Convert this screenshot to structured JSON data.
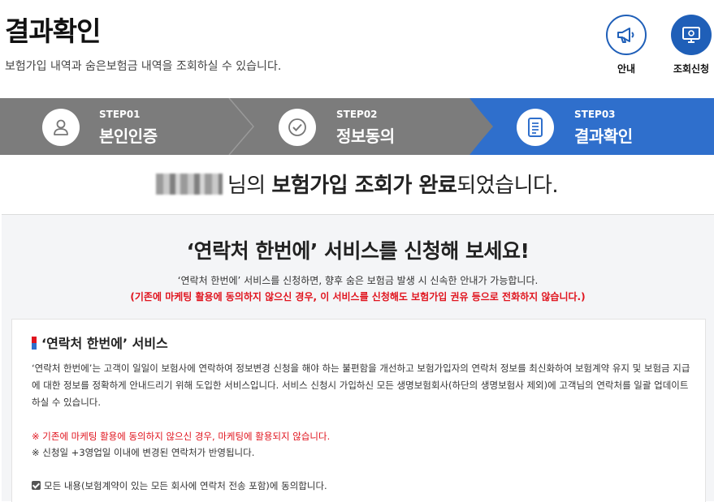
{
  "page": {
    "title": "결과확인",
    "description": "보험가입 내역과 숨은보험금 내역을 조회하실 수 있습니다."
  },
  "top_actions": [
    {
      "label": "안내",
      "icon": "megaphone-icon"
    },
    {
      "label": "조회신청",
      "icon": "monitor-icon"
    }
  ],
  "steps": [
    {
      "no": "STEP01",
      "name": "본인인증",
      "icon": "person-icon",
      "active": false
    },
    {
      "no": "STEP02",
      "name": "정보동의",
      "icon": "check-circle-icon",
      "active": false
    },
    {
      "no": "STEP03",
      "name": "결과확인",
      "icon": "document-icon",
      "active": true
    }
  ],
  "result": {
    "suffix_1": "님의 ",
    "bold": "보험가입 조회가 완료",
    "suffix_2": "되었습니다."
  },
  "promo": {
    "title": "‘연락처 한번에’ 서비스를 신청해 보세요!",
    "subtitle": "‘연락처 한번에’ 서비스를 신청하면, 향후 숨은 보험금 발생 시 신속한 안내가 가능합니다.",
    "warning": "(기존에 마케팅 활용에 동의하지 않으신 경우, 이 서비스를 신청해도 보험가입 권유 등으로 전화하지 않습니다.)"
  },
  "service": {
    "heading": "‘연락처 한번에’ 서비스",
    "body": "‘연락처 한번에’는 고객이 일일이 보험사에 연락하여 정보변경 신청을 해야 하는 불편함을 개선하고 보험가입자의 연락처 정보를 최신화하여 보험계약 유지 및 보험금 지급에 대한 정보를 정확하게 안내드리기 위해 도입한 서비스입니다. 서비스 신청시 가입하신 모든 생명보험회사(하단의 생명보험사 제외)에 고객님의 연락처를 일괄 업데이트 하실 수 있습니다.",
    "note_red": "※ 기존에 마케팅 활용에 동의하지 않으신 경우, 마케팅에 활용되지 않습니다.",
    "note_gray": "※ 신청일 +3영업일 이내에 변경된 연락처가 반영됩니다.",
    "agree_label": "모든 내용(보험계약이 있는 모든 회사에 연락처 전송 포함)에 동의합니다.",
    "agree_checked": true
  },
  "colors": {
    "primary": "#2f6fcc",
    "step_inactive": "#7c7c7c",
    "warning": "#e0141e",
    "panel_bg": "#f4f5f7"
  }
}
